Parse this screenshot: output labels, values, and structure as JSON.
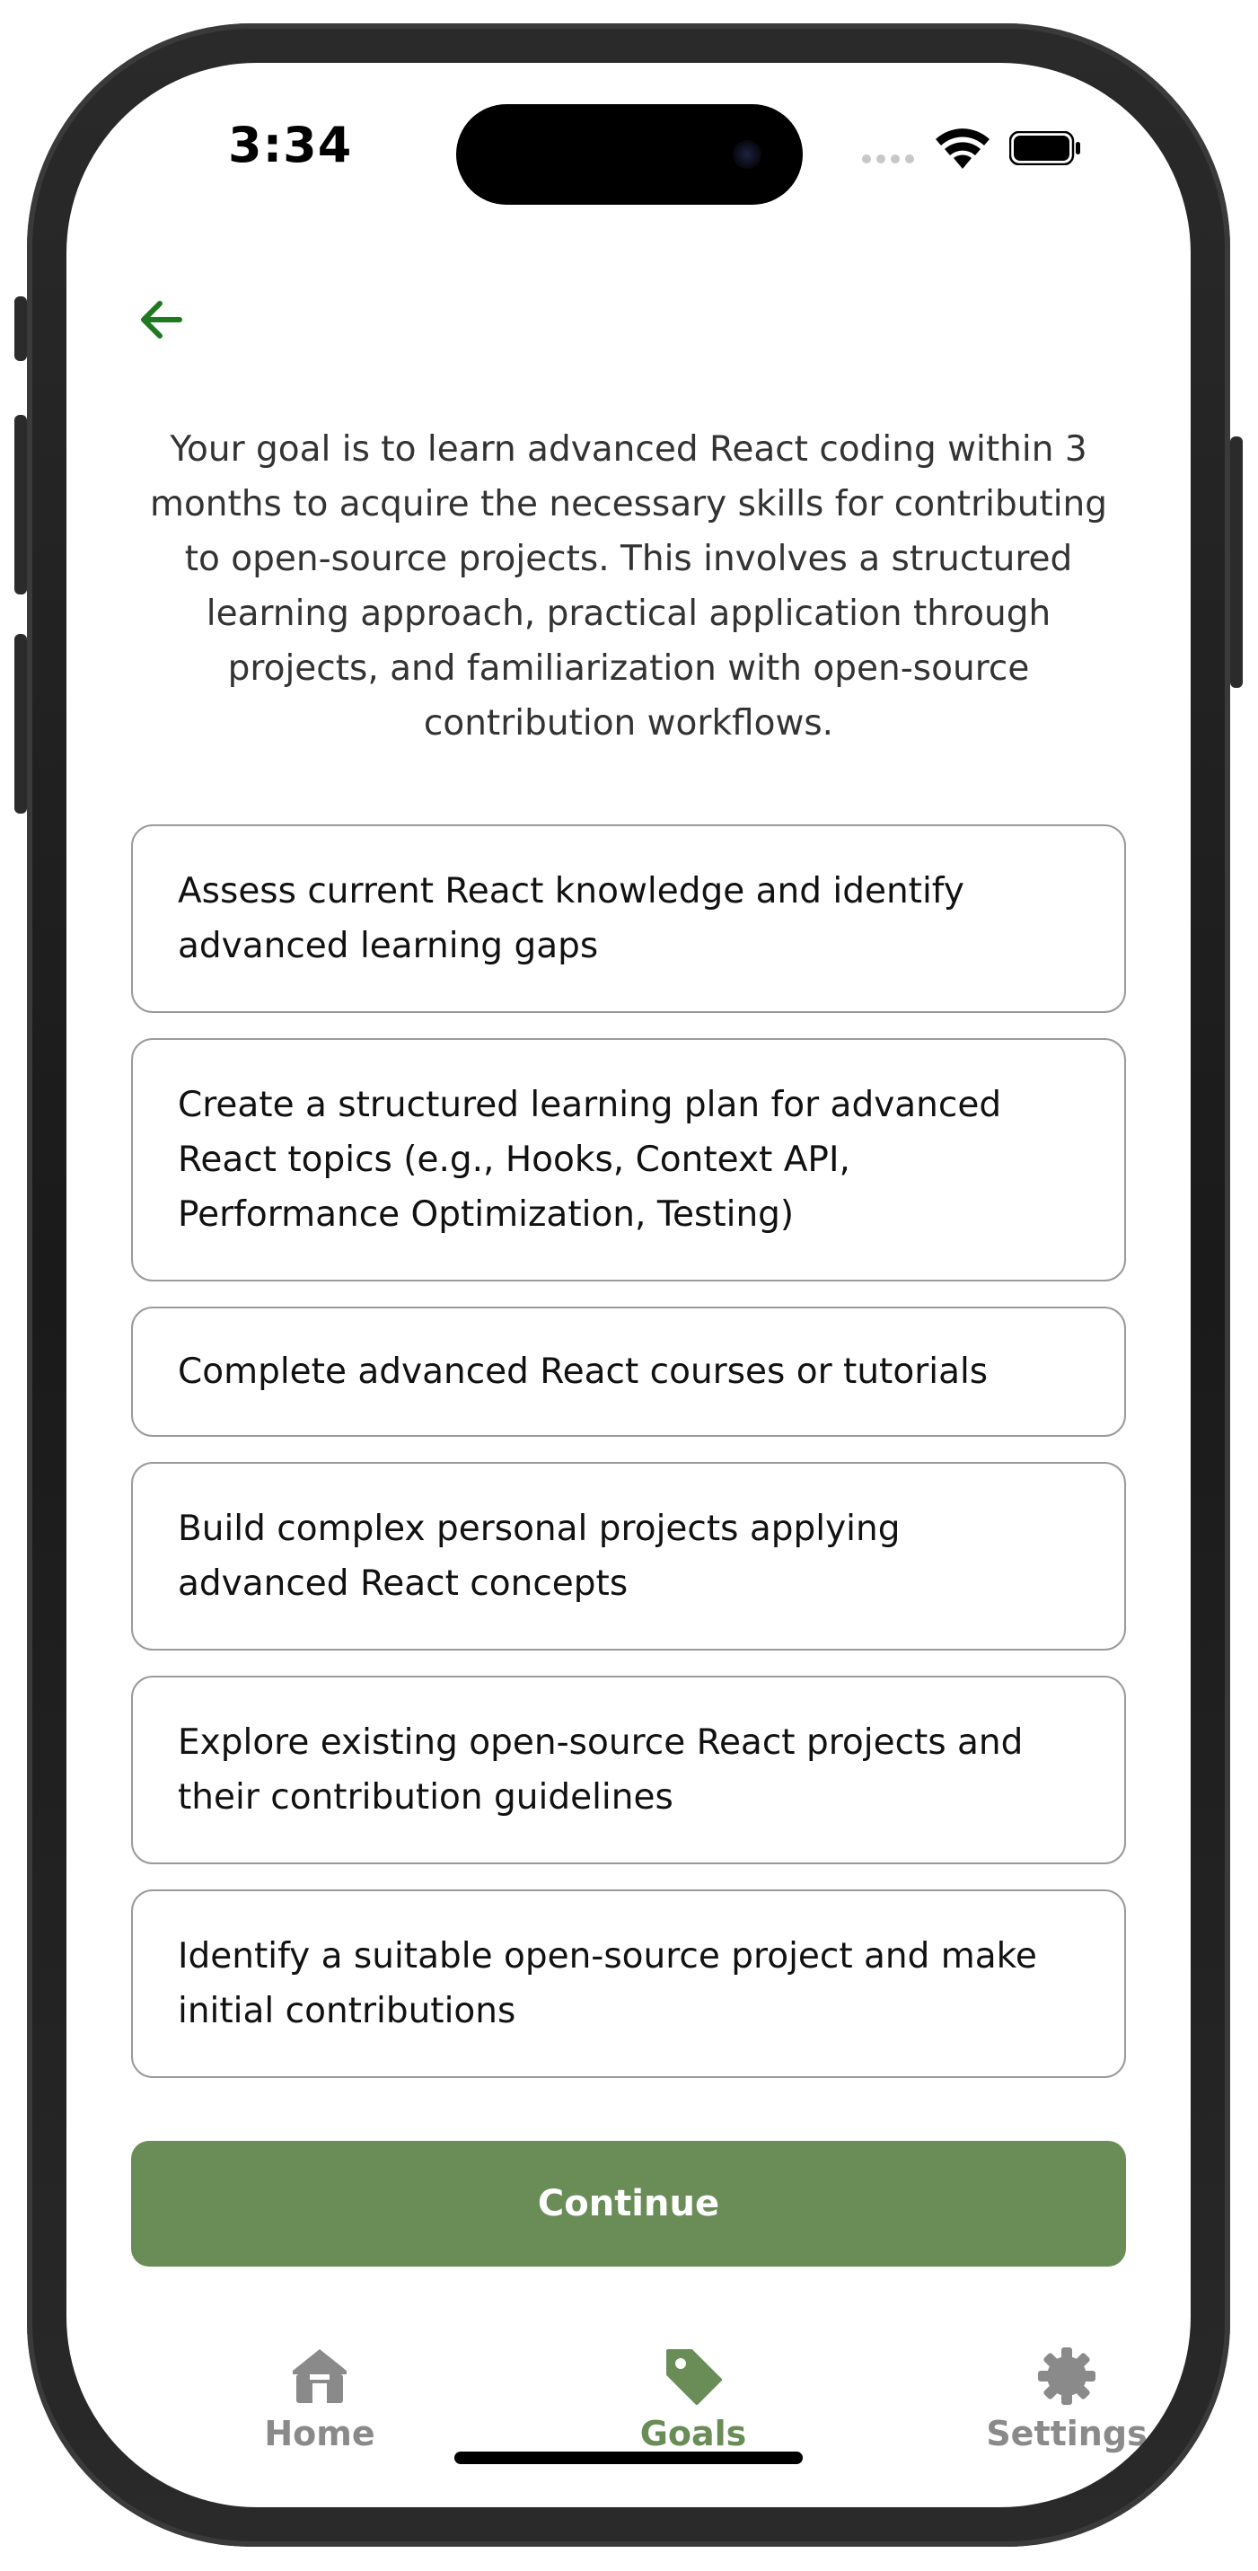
{
  "status_bar": {
    "time": "3:34"
  },
  "header": {
    "back_icon": "arrow-left-icon"
  },
  "summary": "Your goal is to learn advanced React coding within 3 months to acquire the necessary skills for contributing to open-source projects. This involves a structured learning approach, practical application through projects, and familiarization with open-source contribution workflows.",
  "steps": [
    "Assess current React knowledge and identify advanced learning gaps",
    "Create a structured learning plan for advanced React topics (e.g., Hooks, Context API, Performance Optimization, Testing)",
    "Complete advanced React courses or tutorials",
    "Build complex personal projects applying advanced React concepts",
    "Explore existing open-source React projects and their contribution guidelines",
    "Identify a suitable open-source project and make initial contributions"
  ],
  "continue_label": "Continue",
  "tabs": [
    {
      "label": "Home",
      "icon": "home-icon",
      "active": false
    },
    {
      "label": "Goals",
      "icon": "tag-icon",
      "active": true
    },
    {
      "label": "Settings",
      "icon": "gear-icon",
      "active": false
    }
  ],
  "colors": {
    "accent": "#6a8c57",
    "back_arrow": "#1e7a1e",
    "tab_inactive": "#8a8a8a",
    "step_border": "#9a9a9a"
  }
}
